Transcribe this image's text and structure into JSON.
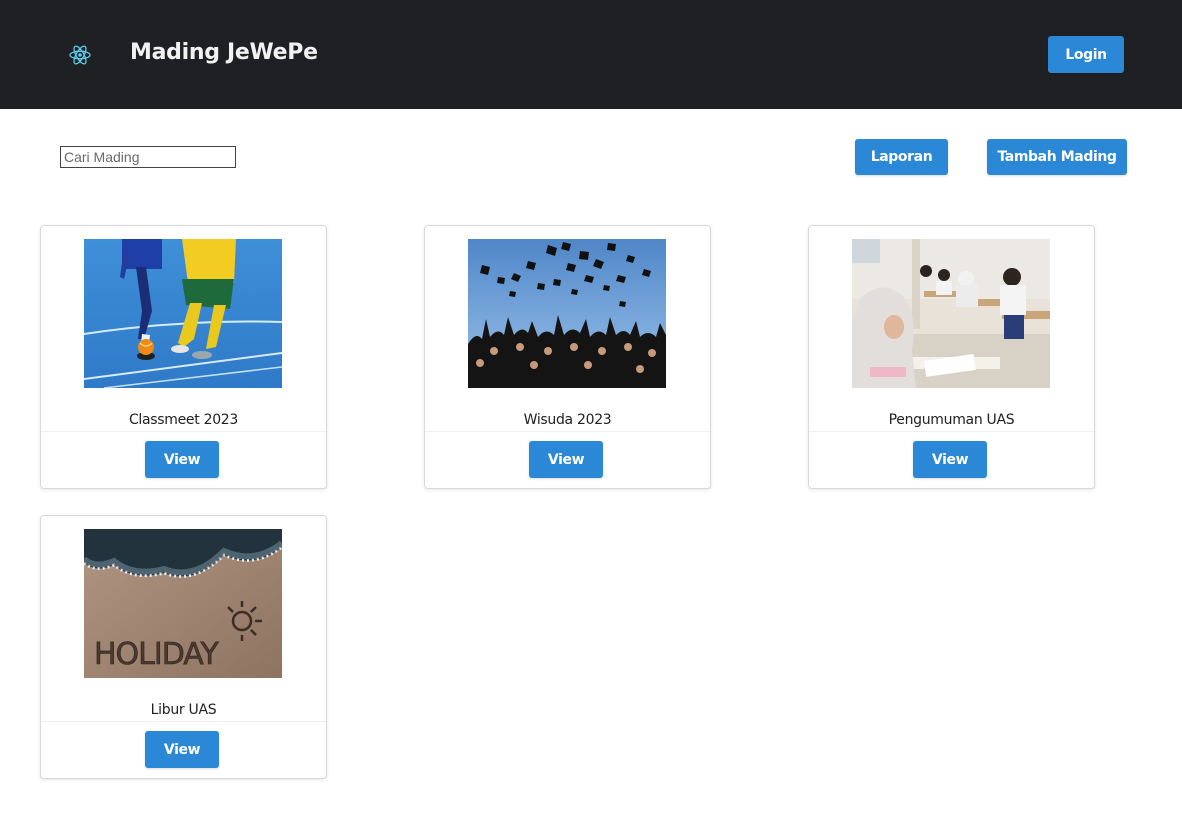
{
  "app": {
    "title": "Mading JeWePe",
    "brand_icon": "react-atom-icon",
    "accent_color": "#2a88d6",
    "navbar_color": "#1f2023"
  },
  "navbar": {
    "login_label": "Login"
  },
  "toolbar": {
    "search_placeholder": "Cari Mading",
    "search_value": "",
    "laporan_label": "Laporan",
    "tambah_label": "Tambah Mading"
  },
  "cards": [
    {
      "title": "Classmeet 2023",
      "image": "futsal-players-photo",
      "button_label": "View"
    },
    {
      "title": "Wisuda 2023",
      "image": "graduation-caps-photo",
      "button_label": "View"
    },
    {
      "title": "Pengumuman UAS",
      "image": "students-exam-photo",
      "button_label": "View"
    },
    {
      "title": "Libur UAS",
      "image": "holiday-sand-photo",
      "button_label": "View"
    }
  ]
}
